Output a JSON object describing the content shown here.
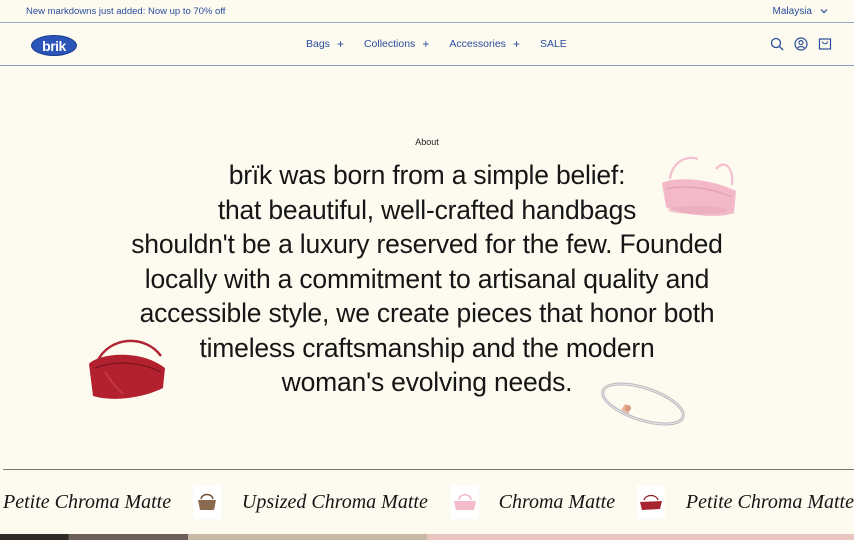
{
  "announcement": {
    "text": "New markdowns just added: Now up to 70% off"
  },
  "region": {
    "label": "Malaysia"
  },
  "header": {
    "logo_text": "brik",
    "nav": [
      {
        "label": "Bags",
        "expandable": true
      },
      {
        "label": "Collections",
        "expandable": true
      },
      {
        "label": "Accessories",
        "expandable": true
      },
      {
        "label": "SALE",
        "expandable": false
      }
    ],
    "icons": [
      "search-icon",
      "account-icon",
      "cart-icon"
    ]
  },
  "about": {
    "eyebrow": "About",
    "lines": [
      "brïk was born from a simple belief:",
      "that beautiful, well-crafted handbags",
      "shouldn't be a luxury reserved for the few. Founded",
      "locally with a commitment to artisanal quality and",
      "accessible style, we create pieces that honor both",
      "timeless craftsmanship and the modern",
      "woman's evolving needs."
    ]
  },
  "marquee": {
    "items": [
      {
        "name": "Petite Chroma Matte",
        "thumb_color": "#8a6a4e"
      },
      {
        "name": "Upsized Chroma Matte",
        "thumb_color": "#f2b8c6"
      },
      {
        "name": "Chroma Matte",
        "thumb_color": "#a8242e"
      },
      {
        "name": "Petite Chroma Matte",
        "thumb_color": "#8a6a4e"
      }
    ]
  },
  "colors": {
    "background": "#fdfbf0",
    "accent": "#2a4c9c",
    "logo": "#2b54b8"
  }
}
